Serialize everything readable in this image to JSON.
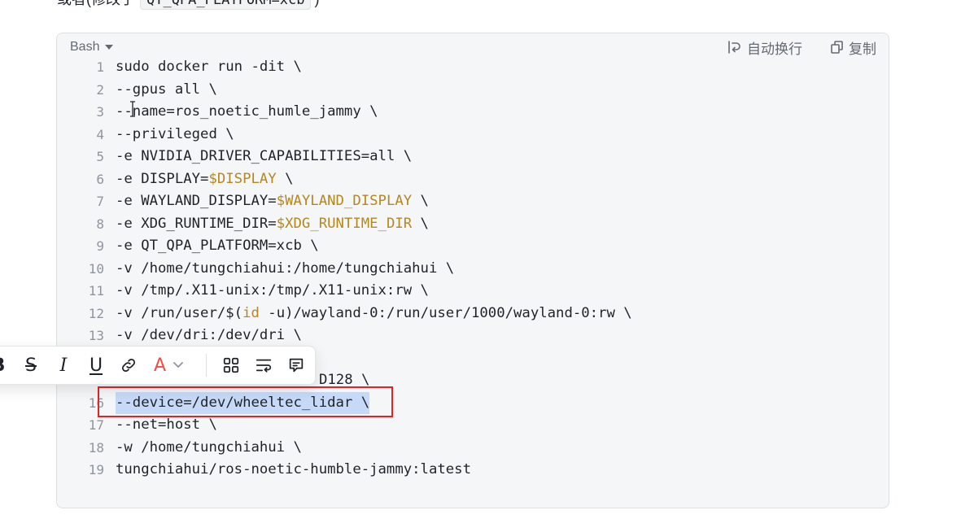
{
  "intro": {
    "prefix": "或者(修改了",
    "code": "QT_QPA_PLATFORM=xcb",
    "suffix": ")"
  },
  "code_block": {
    "language": "Bash",
    "language_dropdown_icon": "chevron-down-icon",
    "wrap_icon": "word-wrap-icon",
    "wrap_label": "自动换行",
    "copy_icon": "copy-icon",
    "copy_label": "复制",
    "lines": [
      {
        "n": "1",
        "segments": [
          {
            "t": "sudo docker run -dit \\"
          }
        ]
      },
      {
        "n": "2",
        "segments": [
          {
            "t": "--gpus all \\"
          }
        ]
      },
      {
        "n": "3",
        "segments": [
          {
            "t": "--name=ros_noetic_humle_jammy \\"
          }
        ]
      },
      {
        "n": "4",
        "segments": [
          {
            "t": "--privileged \\"
          }
        ]
      },
      {
        "n": "5",
        "segments": [
          {
            "t": "-e NVIDIA_DRIVER_CAPABILITIES=all \\"
          }
        ]
      },
      {
        "n": "6",
        "segments": [
          {
            "t": "-e DISPLAY="
          },
          {
            "t": "$DISPLAY",
            "var": true
          },
          {
            "t": " \\"
          }
        ]
      },
      {
        "n": "7",
        "segments": [
          {
            "t": "-e WAYLAND_DISPLAY="
          },
          {
            "t": "$WAYLAND_DISPLAY",
            "var": true
          },
          {
            "t": " \\"
          }
        ]
      },
      {
        "n": "8",
        "segments": [
          {
            "t": "-e XDG_RUNTIME_DIR="
          },
          {
            "t": "$XDG_RUNTIME_DIR",
            "var": true
          },
          {
            "t": " \\"
          }
        ]
      },
      {
        "n": "9",
        "segments": [
          {
            "t": "-e QT_QPA_PLATFORM=xcb \\"
          }
        ]
      },
      {
        "n": "10",
        "segments": [
          {
            "t": "-v /home/tungchiahui:/home/tungchiahui \\"
          }
        ]
      },
      {
        "n": "11",
        "segments": [
          {
            "t": "-v /tmp/.X11-unix:/tmp/.X11-unix:rw \\"
          }
        ]
      },
      {
        "n": "12",
        "segments": [
          {
            "t": "-v /run/user/$("
          },
          {
            "t": "id",
            "var": true
          },
          {
            "t": " -u)/wayland-0:/run/user/1000/wayland-0:rw \\"
          }
        ]
      },
      {
        "n": "13",
        "segments": [
          {
            "t": "-v /dev/dri:/dev/dri \\"
          }
        ]
      },
      {
        "segments": []
      },
      {
        "segments": [
          {
            "t": "D128 \\"
          }
        ]
      },
      {
        "n": "16",
        "selected": true,
        "segments": [
          {
            "t": "--device=/dev/wheeltec_lidar \\"
          }
        ]
      },
      {
        "n": "17",
        "segments": [
          {
            "t": "--net=host \\"
          }
        ]
      },
      {
        "n": "18",
        "segments": [
          {
            "t": "-w /home/tungchiahui \\"
          }
        ]
      },
      {
        "n": "19",
        "segments": [
          {
            "t": "tungchiahui/ros-noetic-humble-jammy:latest"
          }
        ]
      }
    ]
  },
  "toolbar": {
    "bold": "B",
    "strike": "S",
    "italic": "I",
    "underline": "U",
    "text_color": "A",
    "icons": [
      "link-icon",
      "chevron-down-icon",
      "grid-icon",
      "text-wrap-icon",
      "comment-icon"
    ]
  },
  "colors": {
    "code_bg": "#f5f6f7",
    "code_border": "#dee0e3",
    "text": "#1f2329",
    "line_number": "#8f959e",
    "variable": "#b5871f",
    "selection": "#c6d9f7",
    "annotation_box": "#e02424",
    "text_color_red": "#f54a45"
  }
}
